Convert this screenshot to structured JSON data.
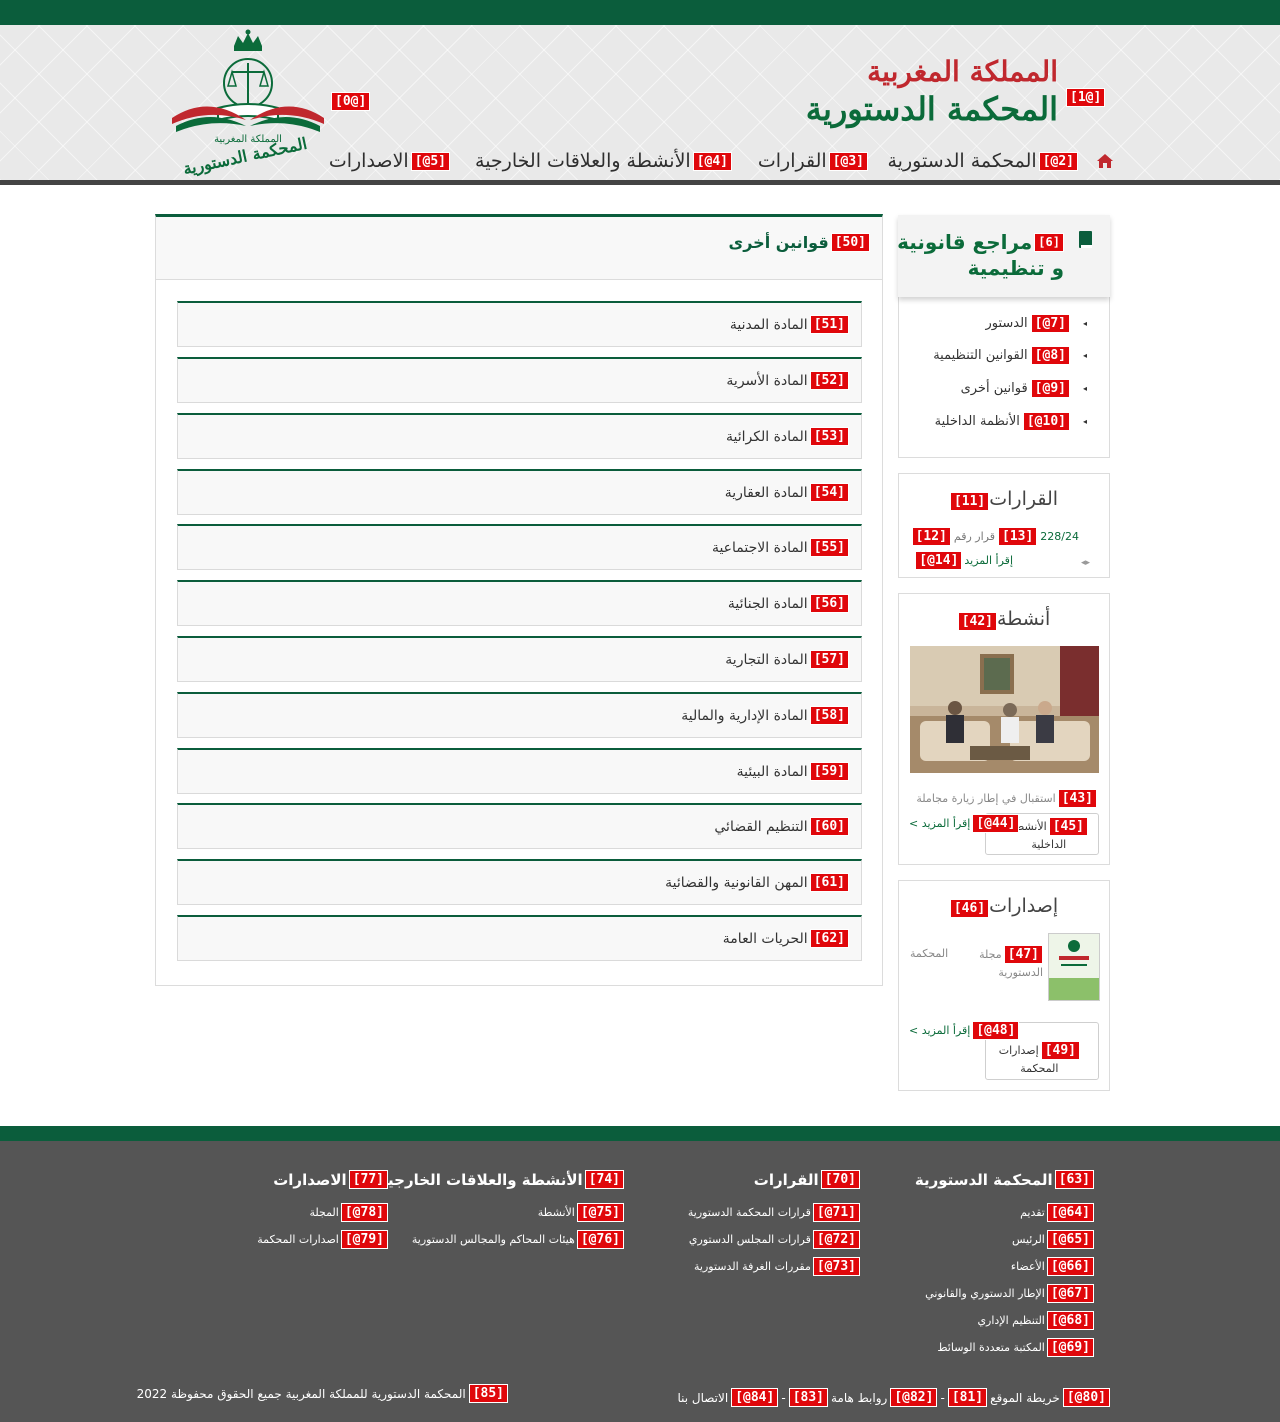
{
  "header": {
    "title_kingdom": "المملكة المغربية",
    "title_court": "المحكمة الدستورية",
    "logo_caption": "المحكمة الدستورية",
    "logo_caption_top": "المملكة المغربية",
    "logo_tag": "[0@]",
    "title_tag": "[1@]"
  },
  "nav": {
    "home_icon": "home-icon",
    "items": [
      {
        "tag": "[2@]",
        "label": "المحكمة الدستورية"
      },
      {
        "tag": "[3@]",
        "label": "القرارات"
      },
      {
        "tag": "[4@]",
        "label": "الأنشطة والعلاقات الخارجية"
      },
      {
        "tag": "[5@]",
        "label": "الاصدارات"
      }
    ]
  },
  "main": {
    "title_tag": "[50]",
    "title": "قوانين أخرى",
    "items": [
      {
        "tag": "[51]",
        "label": "المادة المدنية"
      },
      {
        "tag": "[52]",
        "label": "المادة الأسرية"
      },
      {
        "tag": "[53]",
        "label": "المادة الكرائية"
      },
      {
        "tag": "[54]",
        "label": "المادة العقارية"
      },
      {
        "tag": "[55]",
        "label": "المادة الاجتماعية"
      },
      {
        "tag": "[56]",
        "label": "المادة الجنائية"
      },
      {
        "tag": "[57]",
        "label": "المادة التجارية"
      },
      {
        "tag": "[58]",
        "label": "المادة الإدارية والمالية"
      },
      {
        "tag": "[59]",
        "label": "المادة البيئية"
      },
      {
        "tag": "[60]",
        "label": "التنظيم القضائي"
      },
      {
        "tag": "[61]",
        "label": "المهن القانونية والقضائية"
      },
      {
        "tag": "[62]",
        "label": "الحريات العامة"
      }
    ]
  },
  "sidebar": {
    "refs": {
      "tag": "[6]",
      "title_line1": "مراجع قانونية",
      "title_line2": "و تنظيمية",
      "icon": "book-icon",
      "items": [
        {
          "tag": "[7@]",
          "label": "الدستور"
        },
        {
          "tag": "[8@]",
          "label": "القوانين التنظيمية"
        },
        {
          "tag": "[9@]",
          "label": "قوانين أخرى"
        },
        {
          "tag": "[10@]",
          "label": "الأنظمة الداخلية"
        }
      ]
    },
    "decisions": {
      "tag": "[11]",
      "title": "القرارات",
      "number_tag": "[13]",
      "number": "228/24",
      "prefix": "قرار رقم",
      "item_tag": "[12]",
      "more_tag": "[14@]",
      "more_label": "إقرأ المزيد"
    },
    "activities": {
      "tag": "[42]",
      "title": "أنشطة",
      "caption_tag": "[43]",
      "caption": "استقبال في إطار زيارة مجاملة",
      "more_tag": "[44@]",
      "more_label": "إقرأ المزيد >",
      "cat_tag": "[45]",
      "cat_label_1": "الأنشطة",
      "cat_label_2": "الداخلية"
    },
    "publications": {
      "tag": "[46]",
      "title": "إصدارات",
      "item_tag": "[47]",
      "item_label_1": "مجلة",
      "item_label_2": "الدستورية",
      "item_label_side": "المحكمة",
      "more_tag": "[48@]",
      "more_label": "إقرأ المزيد >",
      "cat_tag": "[49]",
      "cat_label_1": "إصدارات",
      "cat_label_2": "المحكمة"
    }
  },
  "footer": {
    "columns": [
      {
        "tag": "[63]",
        "title": "المحكمة الدستورية",
        "links": [
          {
            "tag": "[64@]",
            "label": "تقديم"
          },
          {
            "tag": "[65@]",
            "label": "الرئيس"
          },
          {
            "tag": "[66@]",
            "label": "الأعضاء"
          },
          {
            "tag": "[67@]",
            "label": "الإطار الدستوري والقانوني"
          },
          {
            "tag": "[68@]",
            "label": "التنظيم الإداري"
          },
          {
            "tag": "[69@]",
            "label": "المكتبة متعددة الوسائط"
          }
        ]
      },
      {
        "tag": "[70]",
        "title": "القرارات",
        "links": [
          {
            "tag": "[71@]",
            "label": "قرارات المحكمة الدستورية"
          },
          {
            "tag": "[72@]",
            "label": "قرارات المجلس الدستوري"
          },
          {
            "tag": "[73@]",
            "label": "مقررات الغرفة الدستورية"
          }
        ]
      },
      {
        "tag": "[74]",
        "title": "الأنشطة والعلاقات الخارجية",
        "links": [
          {
            "tag": "[75@]",
            "label": "الأنشطة"
          },
          {
            "tag": "[76@]",
            "label": "هيئات المحاكم والمجالس الدستورية"
          }
        ]
      },
      {
        "tag": "[77]",
        "title": "الاصدارات",
        "links": [
          {
            "tag": "[78@]",
            "label": "المجلة"
          },
          {
            "tag": "[79@]",
            "label": "اصدارات المحكمة"
          }
        ]
      }
    ],
    "bottom_links": {
      "t80": "[80@]",
      "l80": "خريطة الموقع",
      "t81": "[81]",
      "sep": "-",
      "t82": "[82@]",
      "l82": "روابط هامة",
      "t83": "[83]",
      "t84": "[84@]",
      "l84": "الاتصال بنا"
    },
    "copyright_tag": "[85]",
    "copyright": "المحكمة الدستورية للمملكة المغربية جميع الحقوق محفوظة 2022"
  }
}
